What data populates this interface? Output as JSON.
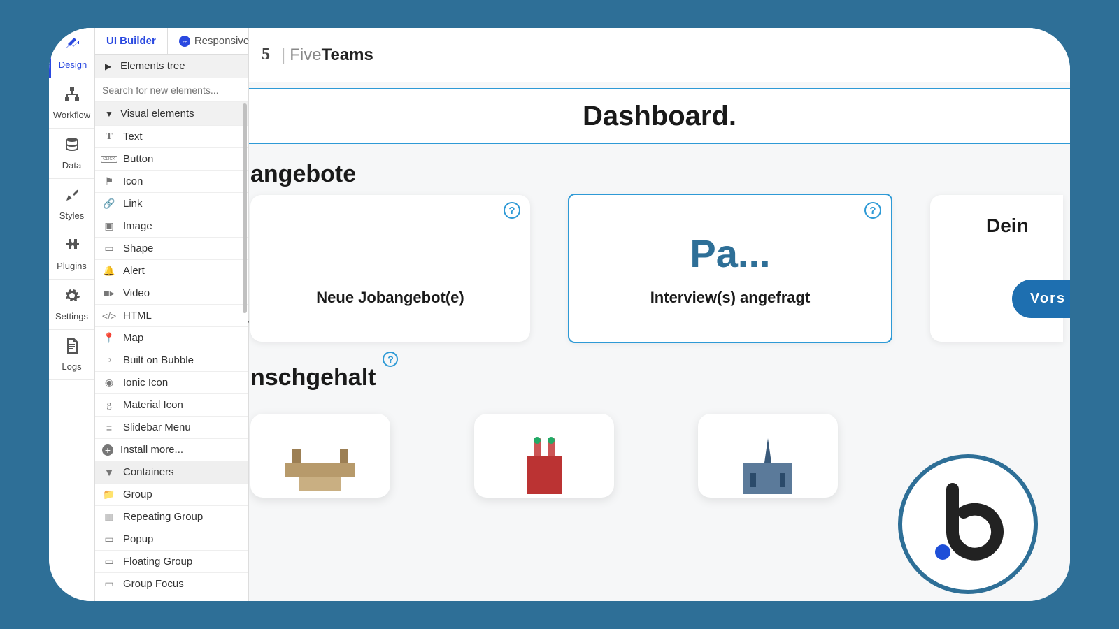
{
  "rail": [
    {
      "label": "Design",
      "icon": "design"
    },
    {
      "label": "Workflow",
      "icon": "workflow"
    },
    {
      "label": "Data",
      "icon": "data"
    },
    {
      "label": "Styles",
      "icon": "styles"
    },
    {
      "label": "Plugins",
      "icon": "plugins"
    },
    {
      "label": "Settings",
      "icon": "settings"
    },
    {
      "label": "Logs",
      "icon": "logs"
    }
  ],
  "panel": {
    "tab_uibuilder": "UI Builder",
    "tab_responsive": "Responsive",
    "elements_tree": "Elements tree",
    "search_placeholder": "Search for new elements...",
    "visual_elements": "Visual elements",
    "items": [
      "Text",
      "Button",
      "Icon",
      "Link",
      "Image",
      "Shape",
      "Alert",
      "Video",
      "HTML",
      "Map",
      "Built on Bubble",
      "Ionic Icon",
      "Material Icon",
      "Slidebar Menu",
      "Install more..."
    ],
    "containers": "Containers",
    "container_items": [
      "Group",
      "Repeating Group",
      "Popup",
      "Floating Group",
      "Group Focus"
    ]
  },
  "app": {
    "brand_prefix": "5",
    "brand_sep": "|",
    "brand_light": "Five",
    "brand_bold": "Teams",
    "dashboard_title": "Dashboard.",
    "section1": "angebote",
    "card1_label": "Neue Jobangebot(e)",
    "card2_big": "Pa...",
    "card2_label": "Interview(s) angefragt",
    "card3_title": "Dein",
    "card3_button": "Vors",
    "section2": "nschgehalt"
  }
}
